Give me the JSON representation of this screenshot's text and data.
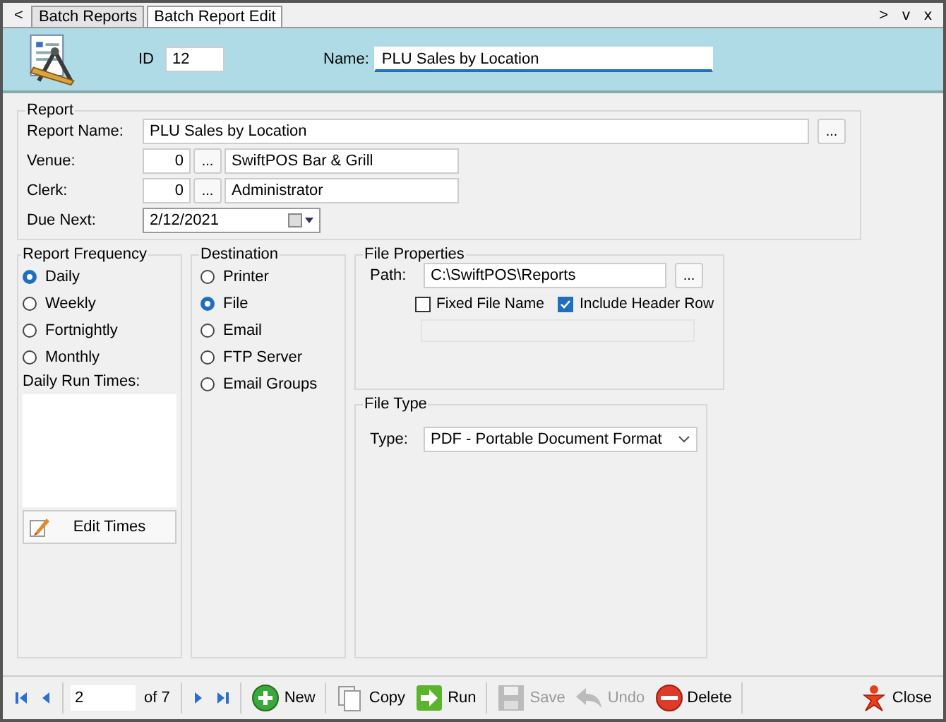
{
  "nav": {
    "prev": "<",
    "next": ">",
    "down": "v",
    "close": "x"
  },
  "tabs": [
    {
      "label": "Batch Reports",
      "selected": false
    },
    {
      "label": "Batch Report Edit",
      "selected": true
    }
  ],
  "header": {
    "id_label": "ID",
    "id_value": "12",
    "name_label": "Name:",
    "name_value": "PLU Sales by Location"
  },
  "report": {
    "title": "Report",
    "report_name_label": "Report Name:",
    "report_name": "PLU Sales by Location",
    "browse": "...",
    "venue_label": "Venue:",
    "venue_code": "0",
    "venue_browse": "...",
    "venue_name": "SwiftPOS Bar & Grill",
    "clerk_label": "Clerk:",
    "clerk_code": "0",
    "clerk_browse": "...",
    "clerk_name": "Administrator",
    "due_label": "Due Next:",
    "due_value": "2/12/2021"
  },
  "frequency": {
    "title": "Report Frequency",
    "options": [
      {
        "label": "Daily",
        "selected": true
      },
      {
        "label": "Weekly",
        "selected": false
      },
      {
        "label": "Fortnightly",
        "selected": false
      },
      {
        "label": "Monthly",
        "selected": false
      }
    ],
    "run_times_label": "Daily Run Times:",
    "edit_button": "Edit Times"
  },
  "destination": {
    "title": "Destination",
    "options": [
      {
        "label": "Printer",
        "selected": false
      },
      {
        "label": "File",
        "selected": true
      },
      {
        "label": "Email",
        "selected": false
      },
      {
        "label": "FTP Server",
        "selected": false
      },
      {
        "label": "Email Groups",
        "selected": false
      }
    ]
  },
  "file_properties": {
    "title": "File Properties",
    "path_label": "Path:",
    "path": "C:\\SwiftPOS\\Reports",
    "browse": "...",
    "checks": [
      {
        "label": "Fixed File Name",
        "checked": false
      },
      {
        "label": "Include Header Row",
        "checked": true
      }
    ]
  },
  "file_type": {
    "title": "File Type",
    "type_label": "Type:",
    "type_value": "PDF - Portable Document Format"
  },
  "toolbar": {
    "record": "2",
    "of": "of 7",
    "buttons": [
      {
        "kind": "new",
        "label": "New",
        "disabled": false
      },
      {
        "kind": "copy",
        "label": "Copy",
        "disabled": false
      },
      {
        "kind": "run",
        "label": "Run",
        "disabled": false
      },
      {
        "kind": "save",
        "label": "Save",
        "disabled": true
      },
      {
        "kind": "undo",
        "label": "Undo",
        "disabled": true
      },
      {
        "kind": "delete",
        "label": "Delete",
        "disabled": false
      }
    ],
    "close": "Close"
  }
}
